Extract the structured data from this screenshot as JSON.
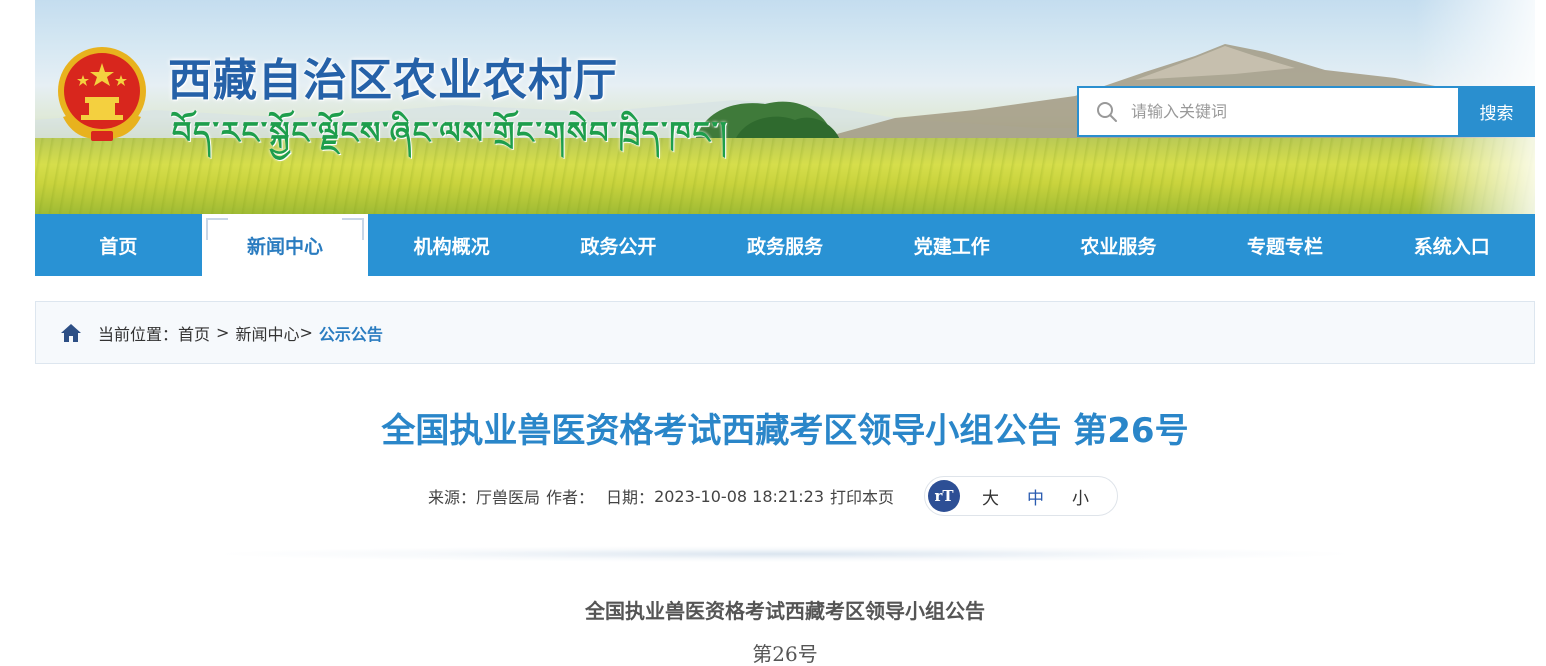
{
  "header": {
    "site_title": "西藏自治区农业农村厅",
    "site_subtitle_tibetan": "བོད་རང་སྐྱོང་ལྗོངས་ཞིང་ལས་གྲོང་གསེབ་ཁྲིད་ཁང་།",
    "emblem": "national-emblem",
    "search": {
      "placeholder": "请输入关键词",
      "button_label": "搜索",
      "icon": "search-icon"
    }
  },
  "nav": {
    "items": [
      {
        "label": "首页",
        "active": false
      },
      {
        "label": "新闻中心",
        "active": true
      },
      {
        "label": "机构概况",
        "active": false
      },
      {
        "label": "政务公开",
        "active": false
      },
      {
        "label": "政务服务",
        "active": false
      },
      {
        "label": "党建工作",
        "active": false
      },
      {
        "label": "农业服务",
        "active": false
      },
      {
        "label": "专题专栏",
        "active": false
      },
      {
        "label": "系统入口",
        "active": false
      }
    ]
  },
  "breadcrumb": {
    "prefix": "当前位置：",
    "items": [
      "首页",
      "新闻中心"
    ],
    "separator": ">",
    "current": "公示公告",
    "icon": "home-icon"
  },
  "article": {
    "title": "全国执业兽医资格考试西藏考区领导小组公告 第26号",
    "meta": {
      "source_label": "来源：",
      "source": "厅兽医局",
      "author_label": "作者：",
      "author": "",
      "date_label": "日期：",
      "date": "2023-10-08 18:21:23",
      "print_label": "打印本页"
    },
    "font_size": {
      "icon_label": "rT",
      "options": [
        "大",
        "中",
        "小"
      ],
      "selected": "中"
    },
    "body_heading": "全国执业兽医资格考试西藏考区领导小组公告",
    "body_number": "第26号"
  },
  "colors": {
    "nav_blue": "#2992d4",
    "title_blue": "#2a86c9",
    "site_title_blue": "#2561a8",
    "tibetan_green": "#1e9e4c"
  }
}
